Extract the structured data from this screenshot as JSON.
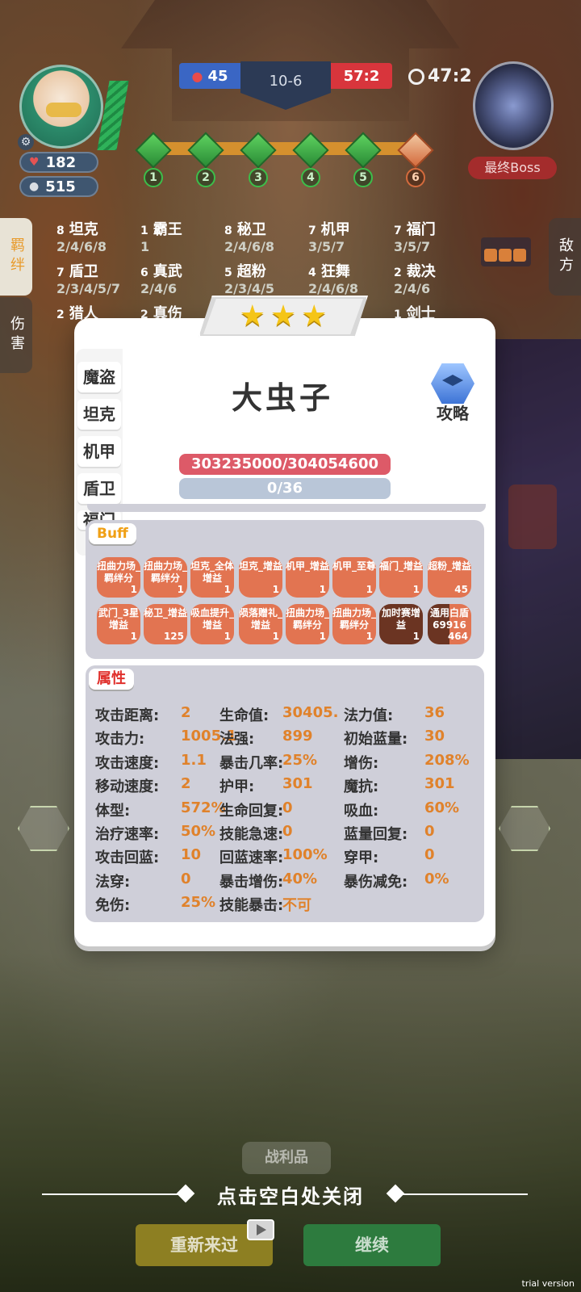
{
  "hud": {
    "hp": "182",
    "coins": "515",
    "blue_score": "45",
    "stage": "10-6",
    "red_score": "57:2",
    "timer": "47:2",
    "boss_label": "最终Boss",
    "stages": [
      "1",
      "2",
      "3",
      "4",
      "5",
      "6"
    ]
  },
  "side_tabs": {
    "bonds": "羁绊",
    "damage": "伤害",
    "enemy": "敌方"
  },
  "bonds": [
    {
      "count": "8",
      "name": "坦克",
      "tiers": "2/4/6/8"
    },
    {
      "count": "1",
      "name": "霸王",
      "tiers": "1"
    },
    {
      "count": "8",
      "name": "秘卫",
      "tiers": "2/4/6/8"
    },
    {
      "count": "7",
      "name": "机甲",
      "tiers": "3/5/7"
    },
    {
      "count": "7",
      "name": "福门",
      "tiers": "3/5/7"
    },
    {
      "count": "7",
      "name": "盾卫",
      "tiers": "2/3/4/5/7"
    },
    {
      "count": "6",
      "name": "真武",
      "tiers": "2/4/6"
    },
    {
      "count": "5",
      "name": "超粉",
      "tiers": "2/3/4/5"
    },
    {
      "count": "4",
      "name": "狂舞",
      "tiers": "2/4/6/8"
    },
    {
      "count": "2",
      "name": "裁决",
      "tiers": "2/4/6"
    },
    {
      "count": "2",
      "name": "猎人",
      "tiers": ""
    },
    {
      "count": "2",
      "name": "真伤",
      "tiers": ""
    },
    {
      "count": "1",
      "name": "剑士",
      "tiers": ""
    }
  ],
  "modal": {
    "stars": 3,
    "unit_name": "大虫子",
    "guide_label": "攻略",
    "tags": [
      "魔盗",
      "坦克",
      "机甲",
      "盾卫",
      "福门"
    ],
    "hp_text": "303235000/304054600",
    "mp_text": "0/36",
    "buff_label": "Buff",
    "attr_label": "属性",
    "buffs": [
      {
        "name": "扭曲力场_羁绊分",
        "count": "1"
      },
      {
        "name": "扭曲力场_羁绊分",
        "count": "1"
      },
      {
        "name": "坦克_全体增益",
        "count": "1"
      },
      {
        "name": "坦克_增益",
        "count": "1"
      },
      {
        "name": "机甲_增益",
        "count": "1"
      },
      {
        "name": "机甲_至尊",
        "count": "1"
      },
      {
        "name": "福门_增益",
        "count": "1"
      },
      {
        "name": "超粉_增益",
        "count": "45"
      },
      {
        "name": "武门_3星增益",
        "count": "1"
      },
      {
        "name": "秘卫_增益",
        "count": "125"
      },
      {
        "name": "吸血提升_增益",
        "count": "1"
      },
      {
        "name": "陨落赠礼_增益",
        "count": "1"
      },
      {
        "name": "扭曲力场_羁绊分",
        "count": "1"
      },
      {
        "name": "扭曲力场_羁绊分",
        "count": "1"
      },
      {
        "name": "加时赛增益",
        "count": "1"
      },
      {
        "name": "通用白盾69916",
        "count": "464"
      }
    ],
    "attributes": [
      [
        {
          "k": "攻击距离:",
          "v": "2"
        },
        {
          "k": "生命值:",
          "v": "30405."
        },
        {
          "k": "法力值:",
          "v": "36"
        }
      ],
      [
        {
          "k": "攻击力:",
          "v": "1005.1"
        },
        {
          "k": "法强:",
          "v": "899"
        },
        {
          "k": "初始蓝量:",
          "v": "30"
        }
      ],
      [
        {
          "k": "攻击速度:",
          "v": "1.1"
        },
        {
          "k": "暴击几率:",
          "v": "25%"
        },
        {
          "k": "增伤:",
          "v": "208%"
        }
      ],
      [
        {
          "k": "移动速度:",
          "v": "2"
        },
        {
          "k": "护甲:",
          "v": "301"
        },
        {
          "k": "魔抗:",
          "v": "301"
        }
      ],
      [
        {
          "k": "体型:",
          "v": "572%"
        },
        {
          "k": "生命回复:",
          "v": "0"
        },
        {
          "k": "吸血:",
          "v": "60%"
        }
      ],
      [
        {
          "k": "治疗速率:",
          "v": "50%"
        },
        {
          "k": "技能急速:",
          "v": "0"
        },
        {
          "k": "蓝量回复:",
          "v": "0"
        }
      ],
      [
        {
          "k": "攻击回蓝:",
          "v": "10"
        },
        {
          "k": "回蓝速率:",
          "v": "100%"
        },
        {
          "k": "穿甲:",
          "v": "0"
        }
      ],
      [
        {
          "k": "法穿:",
          "v": "0"
        },
        {
          "k": "暴击增伤:",
          "v": "40%"
        },
        {
          "k": "暴伤减免:",
          "v": "0%"
        }
      ],
      [
        {
          "k": "免伤:",
          "v": "25%"
        },
        {
          "k": "技能暴击:",
          "v": "不可"
        }
      ]
    ]
  },
  "bottom": {
    "loot_label": "战利品",
    "close_hint": "点击空白处关闭",
    "retry_label": "重新来过",
    "continue_label": "继续",
    "watermark": "trial version"
  },
  "colors": {
    "accent_orange": "#e0822b",
    "buff_chip": "#e27451",
    "hp_bar": "#dd5a68",
    "panel": "#cfcfd9"
  }
}
